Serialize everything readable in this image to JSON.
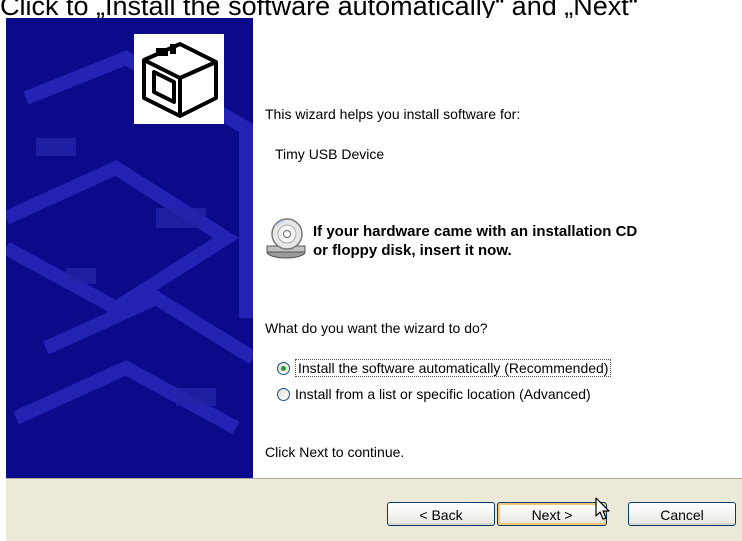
{
  "caption": "Click to „Install the software automatically“ and „Next“",
  "wizard": {
    "intro": "This wizard helps you install software for:",
    "device_name": "Timy USB Device",
    "cd_message_line1": "If your hardware came with an installation CD",
    "cd_message_line2": "or floppy disk, insert it now.",
    "question": "What do you want the wizard to do?",
    "options": [
      {
        "label": "Install the software automatically (Recommended)",
        "checked": true
      },
      {
        "label": "Install from a list or specific location (Advanced)",
        "checked": false
      }
    ],
    "footer_text": "Click Next to continue."
  },
  "buttons": {
    "back": "< Back",
    "next": "Next >",
    "cancel": "Cancel"
  },
  "colors": {
    "side_panel": "#0a0a8a",
    "button_bar": "#ece9d8"
  }
}
